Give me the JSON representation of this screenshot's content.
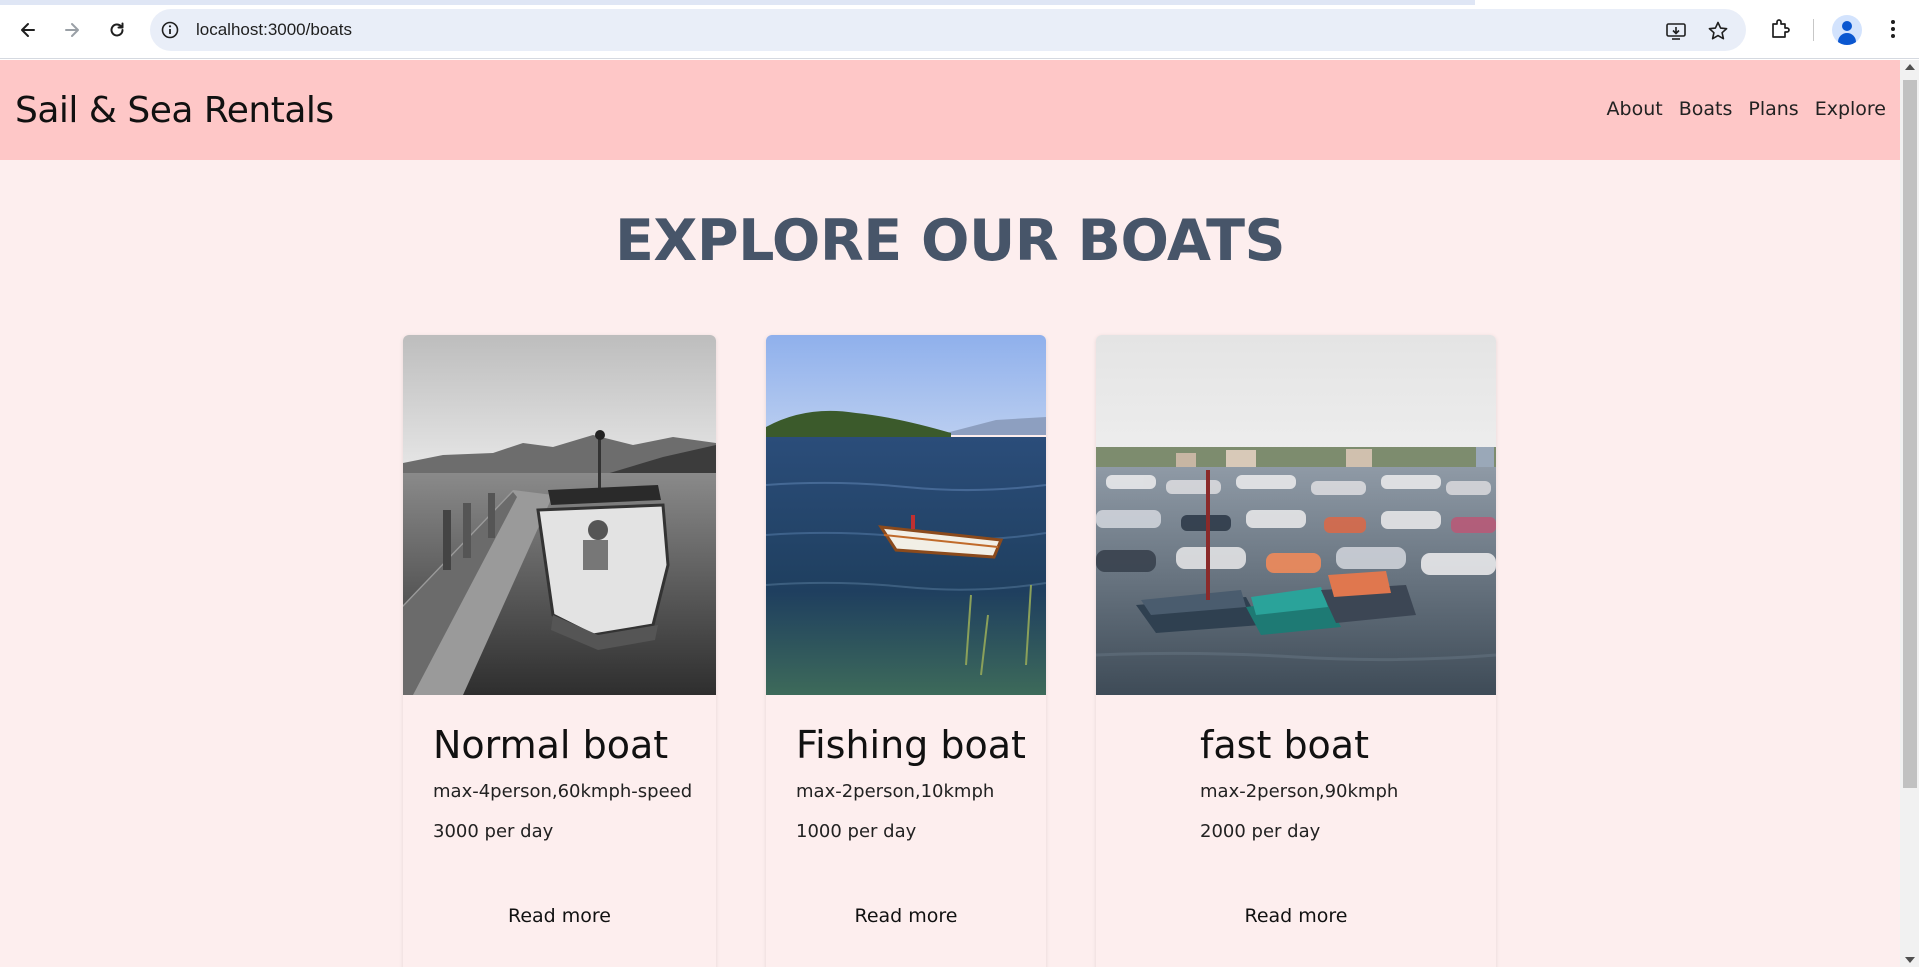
{
  "browser": {
    "url": "localhost:3000/boats"
  },
  "site": {
    "brand": "Sail & Sea Rentals",
    "nav": [
      "About",
      "Boats",
      "Plans",
      "Explore"
    ],
    "page_title": "EXPLORE OUR BOATS"
  },
  "boats": [
    {
      "title": "Normal boat",
      "spec": "max-4person,60kmph-speed",
      "price": "3000 per day",
      "cta": "Read more"
    },
    {
      "title": "Fishing boat",
      "spec": "max-2person,10kmph",
      "price": "1000 per day",
      "cta": "Read more"
    },
    {
      "title": "fast boat",
      "spec": "max-2person,90kmph",
      "price": "2000 per day",
      "cta": "Read more"
    }
  ],
  "colors": {
    "header_bg": "#fec7c7",
    "page_bg": "#fdeeee",
    "title": "#475569"
  }
}
